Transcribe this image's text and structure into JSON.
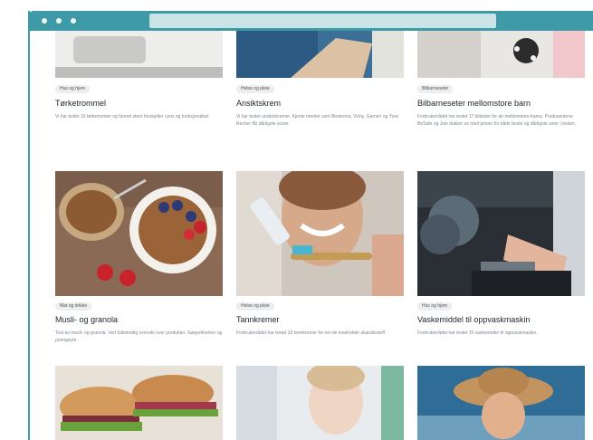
{
  "colors": {
    "accent": "#3d9aa6"
  },
  "cards": [
    {
      "tag": "Hus og hjem",
      "title": "Tørketrommel",
      "desc": "Vi har testet 10 tørketromler og funnet store forskjeller i pris og funksjonalitet."
    },
    {
      "tag": "Helse og pleie",
      "title": "Ansiktskrem",
      "desc": "Vi har testet ansiktskremer. Kjente merker som Bioderma, Vichy, Garnier og Yves Rocher får dårligste score."
    },
    {
      "tag": "Bilbarneseter",
      "title": "Bilbarneseter mellomstore barn",
      "desc": "Forbrukerrådet har testet 17 bilstoler for de mellomstore barna. Produsentene BeSafe og Joie dukker av med prisen for både beste og dårligste seter i testen."
    },
    {
      "tag": "Mat og drikke",
      "title": "Musli- og granola",
      "desc": "Test av musli- og granola. Vert fullstendig oversikt over produkter. Søppelmerker og poengsum."
    },
    {
      "tag": "Helse og pleie",
      "title": "Tannkremer",
      "desc": "Forbrukerrådet har testet 33 tannkremer for om de inneholder skandisstoff."
    },
    {
      "tag": "Hus og hjem",
      "title": "Vaskemiddel til oppvaskmaskin",
      "desc": "Forbrukerrådet har testet 15 vaskemidler til oppvaskmaskin."
    }
  ]
}
